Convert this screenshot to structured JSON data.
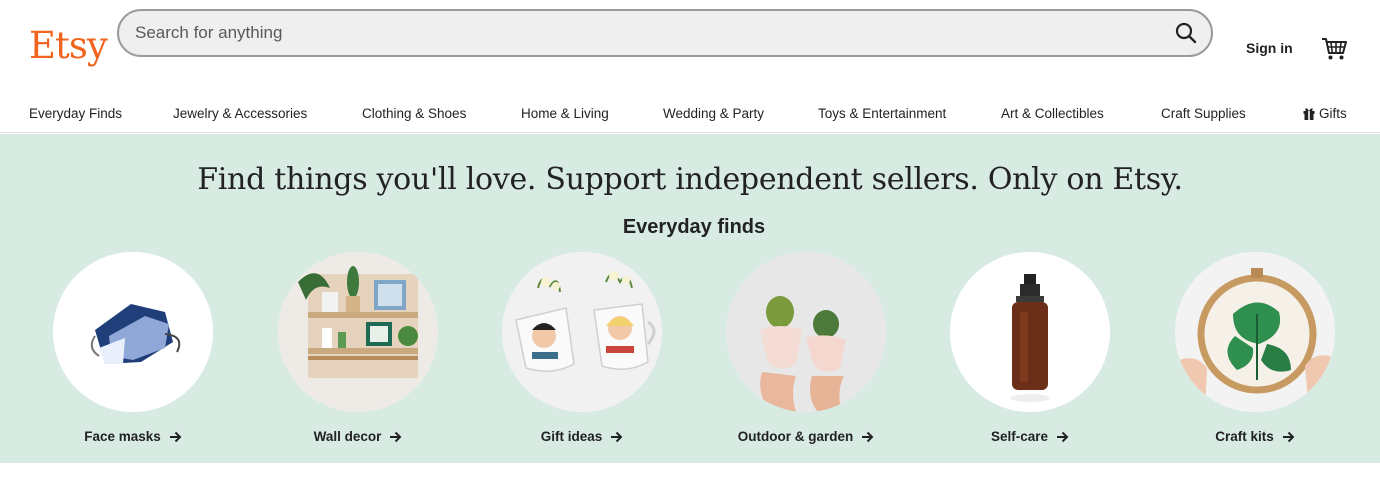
{
  "header": {
    "logo": "Etsy",
    "search_placeholder": "Search for anything",
    "signin_label": "Sign in",
    "brand_color": "#f1641e"
  },
  "nav": {
    "items": [
      {
        "label": "Everyday Finds"
      },
      {
        "label": "Jewelry & Accessories"
      },
      {
        "label": "Clothing & Shoes"
      },
      {
        "label": "Home & Living"
      },
      {
        "label": "Wedding & Party"
      },
      {
        "label": "Toys & Entertainment"
      },
      {
        "label": "Art & Collectibles"
      },
      {
        "label": "Craft Supplies"
      },
      {
        "label": "Gifts",
        "icon": "gift-icon"
      }
    ]
  },
  "hero": {
    "title": "Find things you'll love. Support independent sellers. Only on Etsy.",
    "subtitle": "Everyday finds",
    "background": "#d7ebe3",
    "finds": [
      {
        "label": "Face masks",
        "icon": "face-mask-image"
      },
      {
        "label": "Wall decor",
        "icon": "wall-shelf-image"
      },
      {
        "label": "Gift ideas",
        "icon": "mugs-image"
      },
      {
        "label": "Outdoor & garden",
        "icon": "cactus-image"
      },
      {
        "label": "Self-care",
        "icon": "spray-bottle-image"
      },
      {
        "label": "Craft kits",
        "icon": "embroidery-hoop-image"
      }
    ]
  }
}
